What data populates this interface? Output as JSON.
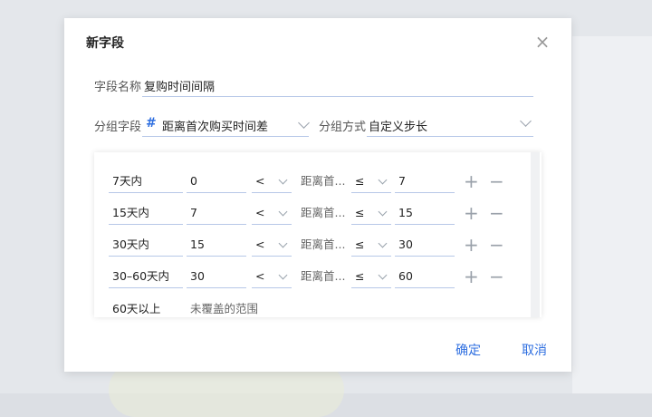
{
  "dialog": {
    "title": "新字段",
    "close_icon": "close-icon",
    "field_name": {
      "label": "字段名称",
      "value": "复购时间间隔"
    },
    "group_field": {
      "label": "分组字段",
      "icon": "#",
      "value": "距离首次购买时间差"
    },
    "group_mode": {
      "label": "分组方式",
      "value": "自定义步长"
    },
    "rules": [
      {
        "name": "7天内",
        "min": "0",
        "op1": "<",
        "field": "距离首...",
        "op2": "≤",
        "max": "7"
      },
      {
        "name": "15天内",
        "min": "7",
        "op1": "<",
        "field": "距离首...",
        "op2": "≤",
        "max": "15"
      },
      {
        "name": "30天内",
        "min": "15",
        "op1": "<",
        "field": "距离首...",
        "op2": "≤",
        "max": "30"
      },
      {
        "name": "30–60天内",
        "min": "30",
        "op1": "<",
        "field": "距离首...",
        "op2": "≤",
        "max": "60"
      }
    ],
    "other_rule": {
      "name": "60天以上",
      "desc": "未覆盖的范围"
    },
    "add_icon": "+",
    "remove_icon": "−",
    "confirm": "确定",
    "cancel": "取消",
    "accent": "#2f6fe0"
  }
}
